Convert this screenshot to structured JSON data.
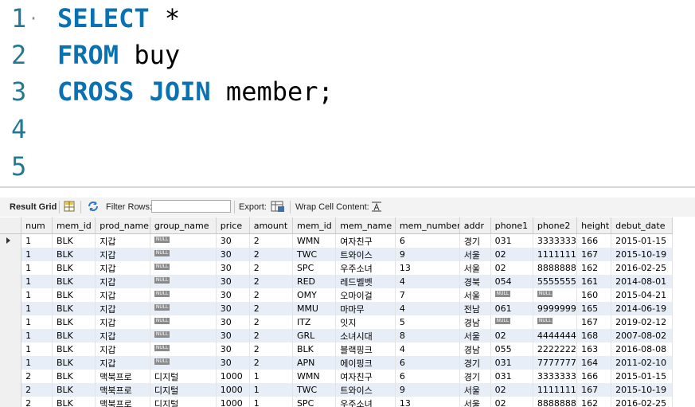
{
  "editor": {
    "lines": [
      {
        "number": "1",
        "marker": "·",
        "keyword": "SELECT",
        "rest": " *"
      },
      {
        "number": "2",
        "marker": "",
        "keyword": "FROM",
        "rest": " buy"
      },
      {
        "number": "3",
        "marker": "",
        "keyword": "CROSS JOIN",
        "rest": " member;"
      },
      {
        "number": "4",
        "marker": "",
        "keyword": "",
        "rest": ""
      },
      {
        "number": "5",
        "marker": "",
        "keyword": "",
        "rest": ""
      }
    ]
  },
  "toolbar": {
    "result_grid_label": "Result Grid",
    "filter_rows_label": "Filter Rows:",
    "filter_rows_value": "",
    "export_label": "Export:",
    "wrap_label": "Wrap Cell Content:"
  },
  "grid": {
    "null_label": "NULL",
    "columns": [
      "num",
      "mem_id",
      "prod_name",
      "group_name",
      "price",
      "amount",
      "mem_id",
      "mem_name",
      "mem_number",
      "addr",
      "phone1",
      "phone2",
      "height",
      "debut_date"
    ],
    "rows": [
      [
        "1",
        "BLK",
        "지갑",
        null,
        "30",
        "2",
        "WMN",
        "여자친구",
        "6",
        "경기",
        "031",
        "33333333",
        "166",
        "2015-01-15"
      ],
      [
        "1",
        "BLK",
        "지갑",
        null,
        "30",
        "2",
        "TWC",
        "트와이스",
        "9",
        "서울",
        "02",
        "11111111",
        "167",
        "2015-10-19"
      ],
      [
        "1",
        "BLK",
        "지갑",
        null,
        "30",
        "2",
        "SPC",
        "우주소녀",
        "13",
        "서울",
        "02",
        "88888888",
        "162",
        "2016-02-25"
      ],
      [
        "1",
        "BLK",
        "지갑",
        null,
        "30",
        "2",
        "RED",
        "레드벨벳",
        "4",
        "경북",
        "054",
        "55555555",
        "161",
        "2014-08-01"
      ],
      [
        "1",
        "BLK",
        "지갑",
        null,
        "30",
        "2",
        "OMY",
        "오마이걸",
        "7",
        "서울",
        null,
        null,
        "160",
        "2015-04-21"
      ],
      [
        "1",
        "BLK",
        "지갑",
        null,
        "30",
        "2",
        "MMU",
        "마마무",
        "4",
        "전남",
        "061",
        "99999999",
        "165",
        "2014-06-19"
      ],
      [
        "1",
        "BLK",
        "지갑",
        null,
        "30",
        "2",
        "ITZ",
        "잇지",
        "5",
        "경남",
        null,
        null,
        "167",
        "2019-02-12"
      ],
      [
        "1",
        "BLK",
        "지갑",
        null,
        "30",
        "2",
        "GRL",
        "소녀시대",
        "8",
        "서울",
        "02",
        "44444444",
        "168",
        "2007-08-02"
      ],
      [
        "1",
        "BLK",
        "지갑",
        null,
        "30",
        "2",
        "BLK",
        "블랙핑크",
        "4",
        "경남",
        "055",
        "22222222",
        "163",
        "2016-08-08"
      ],
      [
        "1",
        "BLK",
        "지갑",
        null,
        "30",
        "2",
        "APN",
        "에이핑크",
        "6",
        "경기",
        "031",
        "77777777",
        "164",
        "2011-02-10"
      ],
      [
        "2",
        "BLK",
        "맥북프로",
        "디지털",
        "1000",
        "1",
        "WMN",
        "여자친구",
        "6",
        "경기",
        "031",
        "33333333",
        "166",
        "2015-01-15"
      ],
      [
        "2",
        "BLK",
        "맥북프로",
        "디지털",
        "1000",
        "1",
        "TWC",
        "트와이스",
        "9",
        "서울",
        "02",
        "11111111",
        "167",
        "2015-10-19"
      ],
      [
        "2",
        "BLK",
        "맥북프로",
        "디지털",
        "1000",
        "1",
        "SPC",
        "우주소녀",
        "13",
        "서울",
        "02",
        "88888888",
        "162",
        "2016-02-25"
      ]
    ]
  }
}
